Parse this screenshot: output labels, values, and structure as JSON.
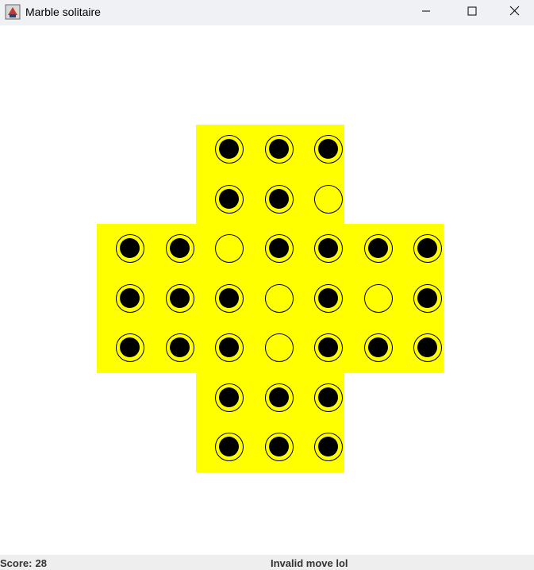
{
  "window": {
    "title": "Marble solitaire",
    "icon": "java-app-icon",
    "controls": [
      "minimize-icon",
      "maximize-icon",
      "close-icon"
    ]
  },
  "board": {
    "color": "#ffff00",
    "marble_color": "#000000",
    "rows": [
      "  OOO  ",
      "  OO_  ",
      "OO_OOOO",
      "OOO_O_O",
      "OOO_OOO",
      "  OOO  ",
      "  OOO  "
    ],
    "legend": {
      "O": "marble",
      "_": "empty",
      " ": "invalid"
    }
  },
  "status": {
    "score_label": "Score:",
    "score_value": "28",
    "message": "Invalid move lol"
  }
}
